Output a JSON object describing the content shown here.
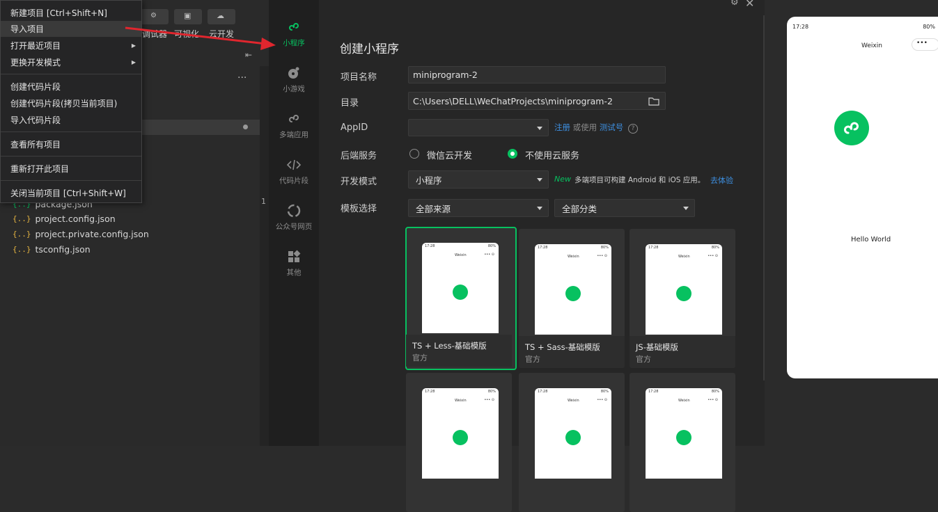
{
  "menu": {
    "items": [
      {
        "label": "新建项目  [Ctrl+Shift+N]"
      },
      {
        "label": "导入项目"
      },
      {
        "label": "打开最近项目"
      },
      {
        "label": "更换开发模式"
      },
      {
        "label": "创建代码片段"
      },
      {
        "label": "创建代码片段(拷贝当前项目)"
      },
      {
        "label": "导入代码片段"
      },
      {
        "label": "查看所有项目"
      },
      {
        "label": "重新打开此项目"
      },
      {
        "label": "关闭当前项目  [Ctrl+Shift+W]"
      }
    ]
  },
  "ide": {
    "toolbar": [
      "调试器",
      "可视化",
      "云开发"
    ],
    "more": "...",
    "files": [
      {
        "icon": "{..}",
        "name": "package.json"
      },
      {
        "icon": "{..}",
        "name": "project.config.json"
      },
      {
        "icon": "{..}",
        "name": "project.private.config.json"
      },
      {
        "icon": "{..}",
        "name": "tsconfig.json"
      }
    ],
    "gutter_number": "1"
  },
  "dialog": {
    "sidebar": [
      {
        "label": "小程序",
        "icon": "miniprogram-icon",
        "active": true
      },
      {
        "label": "小游戏",
        "icon": "minigame-icon"
      },
      {
        "label": "多端应用",
        "icon": "multiplatform-icon"
      },
      {
        "label": "代码片段",
        "icon": "code-snippet-icon"
      },
      {
        "label": "公众号网页",
        "icon": "official-account-icon"
      },
      {
        "label": "其他",
        "icon": "other-icon"
      }
    ],
    "title": "创建小程序",
    "fields": {
      "project_name_label": "项目名称",
      "project_name_value": "miniprogram-2",
      "dir_label": "目录",
      "dir_value": "C:\\Users\\DELL\\WeChatProjects\\miniprogram-2",
      "appid_label": "AppID",
      "appid_value": "",
      "register_link": "注册",
      "or_use": "或使用",
      "test_link": "测试号",
      "help": "?",
      "backend_label": "后端服务",
      "backend_opt1": "微信云开发",
      "backend_opt2": "不使用云服务",
      "dev_mode_label": "开发模式",
      "dev_mode_value": "小程序",
      "new_tag": "New",
      "new_desc": "多端项目可构建 Android 和 iOS 应用。",
      "try_link": "去体验",
      "template_label": "模板选择",
      "source_value": "全部来源",
      "category_value": "全部分类"
    },
    "templates": [
      {
        "name": "TS + Less-基础模版",
        "source": "官方",
        "selected": true
      },
      {
        "name": "TS + Sass-基础模版",
        "source": "官方"
      },
      {
        "name": "JS-基础模版",
        "source": "官方"
      },
      {
        "name": "",
        "source": ""
      },
      {
        "name": "",
        "source": ""
      },
      {
        "name": "",
        "source": ""
      }
    ],
    "thumb": {
      "time": "17:28",
      "app": "Weixin",
      "battery": "80%",
      "dots": "•••  ⊙"
    }
  },
  "preview": {
    "time": "17:28",
    "battery": "80%",
    "app_name": "Weixin",
    "capsule": "•••",
    "hello": "Hello World"
  },
  "colors": {
    "accent": "#07c160",
    "link": "#3d8fe0",
    "arrow": "#e0262e"
  }
}
